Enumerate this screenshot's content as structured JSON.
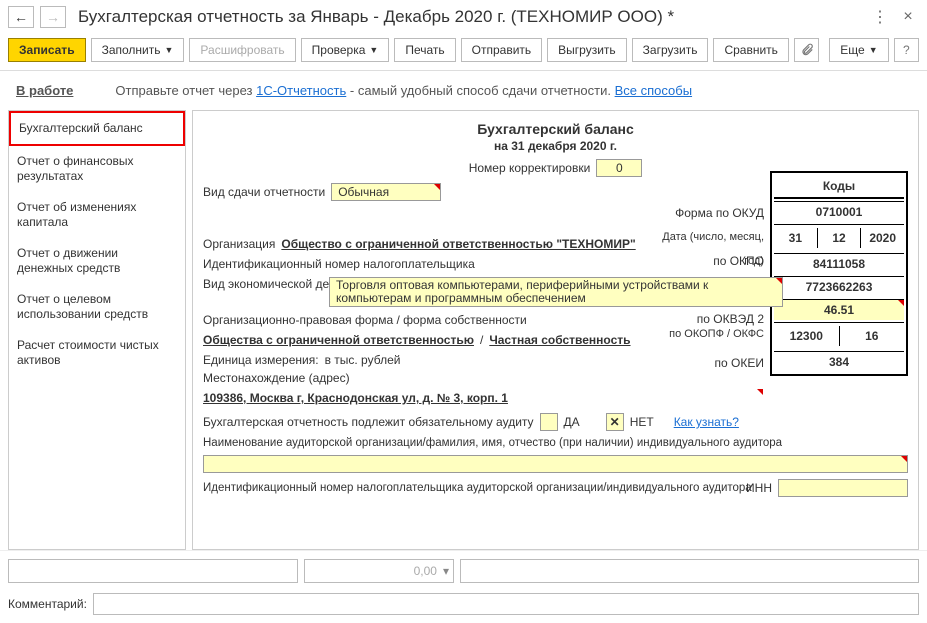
{
  "title": "Бухгалтерская отчетность за Январь - Декабрь 2020 г. (ТЕХНОМИР ООО) *",
  "toolbar": {
    "save": "Записать",
    "fill": "Заполнить",
    "decode": "Расшифровать",
    "check": "Проверка",
    "print": "Печать",
    "send": "Отправить",
    "unload": "Выгрузить",
    "load": "Загрузить",
    "compare": "Сравнить",
    "more": "Еще"
  },
  "info": {
    "label": "В работе",
    "text1": "Отправьте отчет через ",
    "link1": "1С-Отчетность",
    "text2": " - самый удобный способ сдачи отчетности. ",
    "link2": "Все способы"
  },
  "sidebar": [
    "Бухгалтерский баланс",
    "Отчет о финансовых результатах",
    "Отчет об изменениях капитала",
    "Отчет о движении денежных средств",
    "Отчет о целевом использовании средств",
    "Расчет стоимости чистых активов"
  ],
  "form": {
    "heading": "Бухгалтерский баланс",
    "date": "на 31 декабря 2020 г.",
    "corr_num_label": "Номер корректировки",
    "corr_num": "0",
    "submit_type_label": "Вид сдачи отчетности",
    "submit_type": "Обычная",
    "org_label": "Организация",
    "org": "Общество с ограниченной ответственностью \"ТЕХНОМИР\"",
    "inn_label": "Идентификационный номер налогоплательщика",
    "activity_label": "Вид экономической деятельности",
    "activity": "Торговля оптовая компьютерами, периферийными устройствами к компьютерам и программным обеспечением",
    "legal_form_label": "Организационно-правовая форма / форма собственности",
    "legal_form1": "Общества с ограниченной ответственностью",
    "legal_form_sep": "/",
    "legal_form2": "Частная собственность",
    "unit_label": "Единица измерения:",
    "unit": "в тыс. рублей",
    "addr_label": "Местонахождение (адрес)",
    "addr": "109386, Москва г, Краснодонская ул, д. № 3, корп. 1",
    "audit_label": "Бухгалтерская отчетность подлежит обязательному аудиту",
    "audit_yes": "ДА",
    "audit_no": "НЕТ",
    "audit_link": "Как узнать?",
    "auditor_label": "Наименование аудиторской организации/фамилия, имя, отчество (при наличии) индивидуального аудитора",
    "auditor_inn_label": "Идентификационный номер налогоплательщика аудиторской организации/индивидуального аудитора",
    "auditor_inn_short": "ИНН"
  },
  "codes": {
    "header": "Коды",
    "okud_label": "Форма по ОКУД",
    "okud": "0710001",
    "date_label": "Дата (число, месяц, год)",
    "day": "31",
    "month": "12",
    "year": "2020",
    "okpo_label": "по ОКПО",
    "okpo": "84111058",
    "inn_label": "ИНН",
    "inn": "7723662263",
    "okved_label": "по ОКВЭД 2",
    "okved": "46.51",
    "okopf_label": "по ОКОПФ / ОКФС",
    "okopf": "12300",
    "okfs": "16",
    "okei_label": "по ОКЕИ",
    "okei": "384"
  },
  "footer": {
    "num_placeholder": "0,00",
    "comment_label": "Комментарий:"
  }
}
